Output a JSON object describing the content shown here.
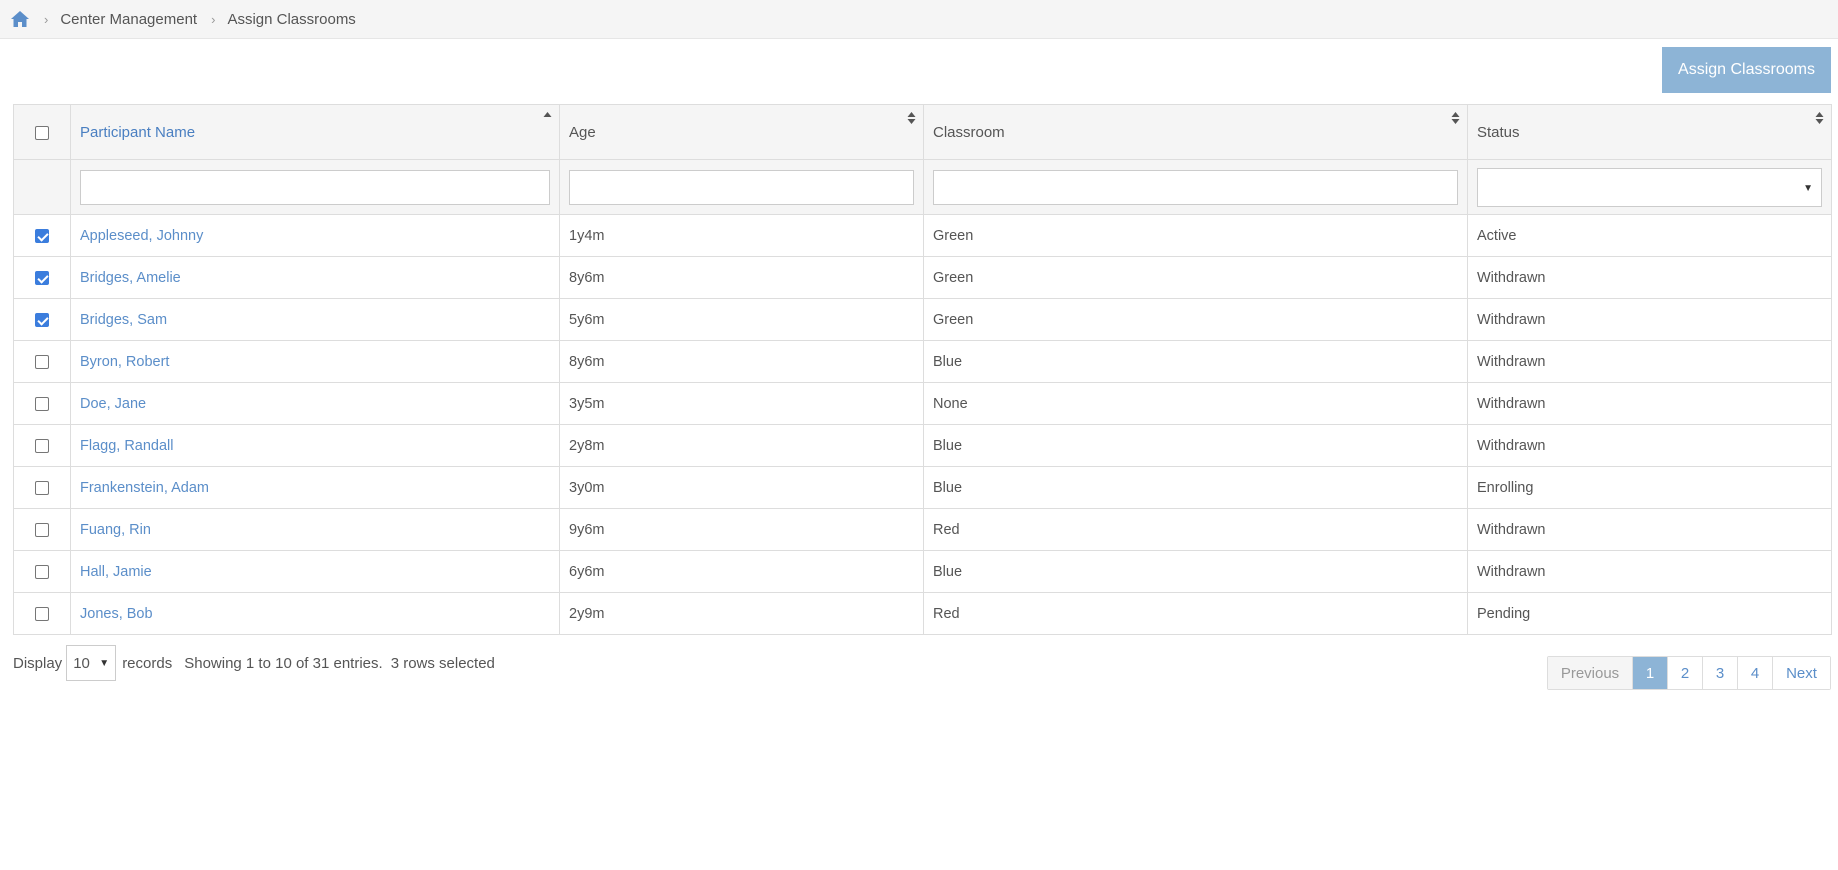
{
  "breadcrumb": {
    "items": [
      "Center Management",
      "Assign Classrooms"
    ]
  },
  "toolbar": {
    "assign_label": "Assign Classrooms"
  },
  "table": {
    "columns": [
      "Participant Name",
      "Age",
      "Classroom",
      "Status"
    ],
    "rows": [
      {
        "name": "Appleseed, Johnny",
        "age": "1y4m",
        "classroom": "Green",
        "status": "Active",
        "checked": true
      },
      {
        "name": "Bridges, Amelie",
        "age": "8y6m",
        "classroom": "Green",
        "status": "Withdrawn",
        "checked": true
      },
      {
        "name": "Bridges, Sam",
        "age": "5y6m",
        "classroom": "Green",
        "status": "Withdrawn",
        "checked": true
      },
      {
        "name": "Byron, Robert",
        "age": "8y6m",
        "classroom": "Blue",
        "status": "Withdrawn",
        "checked": false
      },
      {
        "name": "Doe, Jane",
        "age": "3y5m",
        "classroom": "None",
        "status": "Withdrawn",
        "checked": false
      },
      {
        "name": "Flagg, Randall",
        "age": "2y8m",
        "classroom": "Blue",
        "status": "Withdrawn",
        "checked": false
      },
      {
        "name": "Frankenstein, Adam",
        "age": "3y0m",
        "classroom": "Blue",
        "status": "Enrolling",
        "checked": false
      },
      {
        "name": "Fuang, Rin",
        "age": "9y6m",
        "classroom": "Red",
        "status": "Withdrawn",
        "checked": false
      },
      {
        "name": "Hall, Jamie",
        "age": "6y6m",
        "classroom": "Blue",
        "status": "Withdrawn",
        "checked": false
      },
      {
        "name": "Jones, Bob",
        "age": "2y9m",
        "classroom": "Red",
        "status": "Pending",
        "checked": false
      }
    ]
  },
  "footer": {
    "display_label": "Display",
    "page_length": "10",
    "records_label": "records",
    "info": "Showing 1 to 10 of 31 entries.",
    "selected_info": "3 rows selected"
  },
  "pagination": {
    "previous": "Previous",
    "pages": [
      "1",
      "2",
      "3",
      "4"
    ],
    "current": "1",
    "next": "Next"
  },
  "colors": {
    "accent": "#8db4d6",
    "link": "#5b8ec9",
    "header_bg": "#f5f5f5"
  }
}
